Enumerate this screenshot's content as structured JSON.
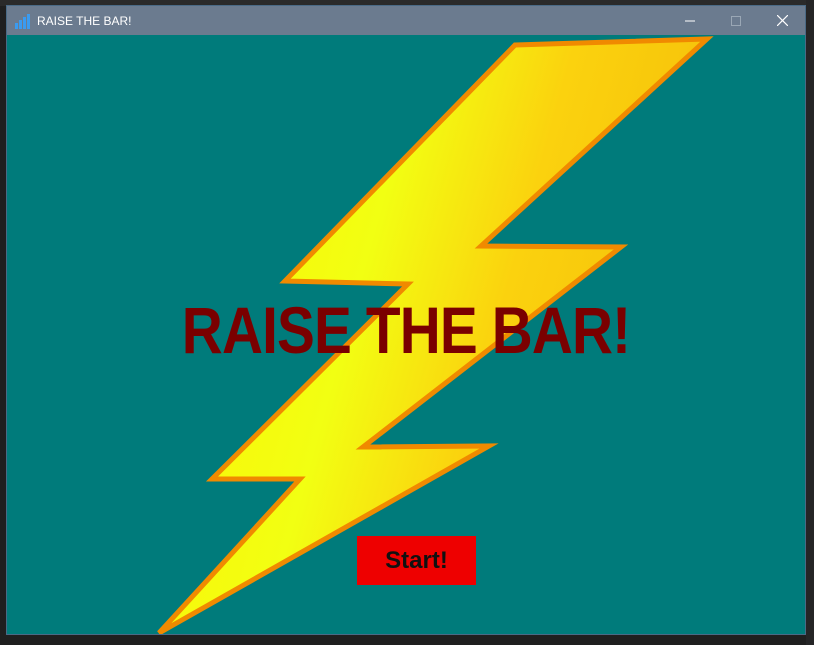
{
  "window": {
    "title": "RAISE THE BAR!",
    "icon": "bar-chart-icon",
    "controls": {
      "minimize": "—",
      "maximize": "☐",
      "close": "✕"
    }
  },
  "game": {
    "title": "RAISE THE BAR!",
    "start_label": "Start!",
    "background_color": "#007b7b",
    "title_color": "#7a0000",
    "button_color": "#ee0000",
    "bolt_icon": "lightning-bolt"
  }
}
